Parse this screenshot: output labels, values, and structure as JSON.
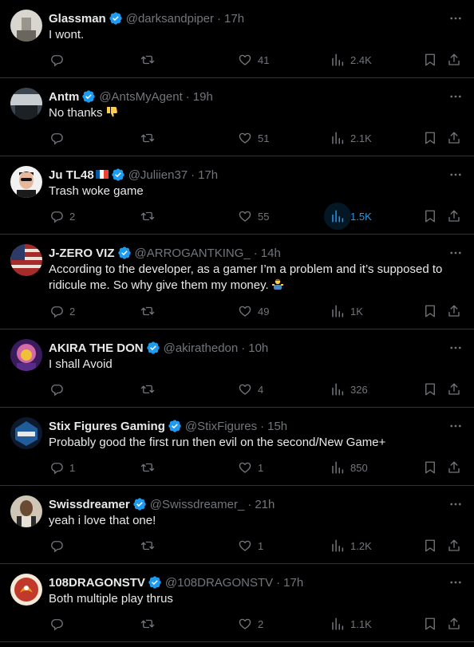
{
  "colors": {
    "background": "#000000",
    "text": "#e7e9ea",
    "muted": "#71767b",
    "accent": "#1d9bf0",
    "divider": "#2f3336"
  },
  "tweets": [
    {
      "name": "Glassman",
      "handle": "@darksandpiper",
      "time": "17h",
      "text": "I wont.",
      "replies": "",
      "retweets": "",
      "likes": "41",
      "views": "2.4K"
    },
    {
      "name": "Antm",
      "handle": "@AntsMyAgent",
      "time": "19h",
      "text": "No thanks",
      "emoji": "thumbs-down",
      "replies": "",
      "retweets": "",
      "likes": "51",
      "views": "2.1K"
    },
    {
      "name": "Ju TL48",
      "handle": "@Juliien37",
      "time": "17h",
      "text": "Trash woke game",
      "flag": "france",
      "replies": "2",
      "retweets": "",
      "likes": "55",
      "views": "1.5K",
      "views_hover": true
    },
    {
      "name": "J-ZERO VIZ",
      "handle": "@ARROGANTKING_",
      "time": "14h",
      "text": "According to the developer, as a gamer I’m a problem and it’s supposed to ridicule me. So why give them my money.",
      "emoji": "person-shrugging",
      "replies": "2",
      "retweets": "",
      "likes": "49",
      "views": "1K"
    },
    {
      "name": "AKIRA THE DON",
      "handle": "@akirathedon",
      "time": "10h",
      "text": "I shall Avoid",
      "replies": "",
      "retweets": "",
      "likes": "4",
      "views": "326"
    },
    {
      "name": "Stix Figures Gaming",
      "handle": "@StixFigures",
      "time": "15h",
      "text": "Probably good the first run then evil on the second/New Game+",
      "replies": "1",
      "retweets": "",
      "likes": "1",
      "views": "850"
    },
    {
      "name": "Swissdreamer",
      "handle": "@Swissdreamer_",
      "time": "21h",
      "text": "yeah i love that one!",
      "replies": "",
      "retweets": "",
      "likes": "1",
      "views": "1.2K"
    },
    {
      "name": "108DRAGONSTV",
      "handle": "@108DRAGONSTV",
      "time": "17h",
      "text": "Both multiple play thrus",
      "replies": "",
      "retweets": "",
      "likes": "2",
      "views": "1.1K"
    }
  ],
  "separator": "·",
  "icons": [
    "reply-icon",
    "retweet-icon",
    "like-icon",
    "views-icon",
    "bookmark-icon",
    "share-icon",
    "more-icon",
    "verified-badge-icon"
  ]
}
